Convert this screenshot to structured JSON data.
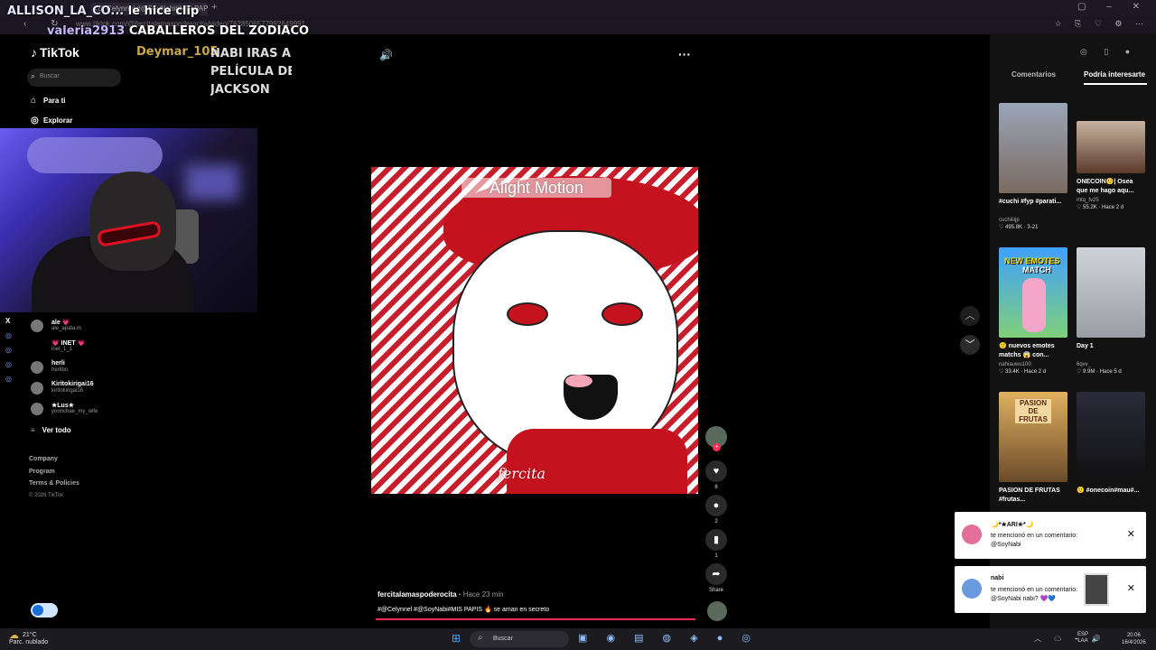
{
  "browser": {
    "tab_title": "(8) Celynnel #@SoyNabi#MIS PAPI...",
    "url": "www.tiktok.com/@fercitalamaspoderocita/video/7628506577992649991"
  },
  "stream_overlay": {
    "line1_name": "ALLISON_LA_CO...",
    "line1_msg": "le hice clip",
    "line2_user": "valeria2913",
    "line2_msg": "CABALLEROS DEL ZODIACO",
    "deymar": "Deymar_105",
    "nabi_line1": "NABI IRAS A V",
    "nabi_line2": "PELÍCULA DE I",
    "nabi_line3": "JACKSON"
  },
  "sidebar": {
    "logo": "TikTok",
    "search_placeholder": "Buscar",
    "nav": [
      {
        "label": "Para ti",
        "icon": "home-icon"
      },
      {
        "label": "Explorar",
        "icon": "compass-icon"
      }
    ],
    "following": [
      {
        "name": "ale 💗",
        "handle": "ale_apata.m"
      },
      {
        "name": "💗 INET 💗",
        "handle": "inet_1_1"
      },
      {
        "name": "herli",
        "handle": "herlibo"
      },
      {
        "name": "Kiritokirigai16",
        "handle": "kiritokirigai16"
      },
      {
        "name": "★Lus★",
        "handle": "yoonchae_my_wife"
      }
    ],
    "ver_todo": "Ver todo",
    "footer": [
      "Company",
      "Program",
      "Terms & Policies"
    ],
    "copyright": "© 2026 TikTok"
  },
  "video": {
    "watermark": "Alight Motion",
    "signature": "fercita",
    "author": "fercitalamaspoderocita",
    "time": "Hace 23 min",
    "caption": "#@Celynnel #@SoyNabi#MIS PAPIS 🔥 se aman en secreto",
    "progress": 1.0
  },
  "actions": {
    "likes": "8",
    "comments": "2",
    "saves": "1",
    "share": "Share"
  },
  "right_panel": {
    "tab_comments": "Comentarios",
    "tab_interest": "Podría interesarte",
    "cards": [
      {
        "title": "#cuchi #fyp #parati...",
        "user": "cuchiiiijp",
        "stats": "♡ 495.8K · 3-21"
      },
      {
        "title": "ONECOIN🙂| Osea que me hago aqu...",
        "user": "mtq_fv25",
        "stats": "♡ 55.2K · Hace 2 d"
      },
      {
        "title": "🙂 nuevos emotes matchs 😱 con...",
        "user": "nahiauwu100",
        "stats": "♡ 33.4K · Hace 2 d"
      },
      {
        "title": "Day 1",
        "user": "6qvv_",
        "stats": "♡ 9.9M · Hace 5 d"
      },
      {
        "title": "PASION DE FRUTAS #frutas...",
        "user": "",
        "stats": ""
      },
      {
        "title": "🙂 #onecoin#mau#...",
        "user": "",
        "stats": ""
      }
    ],
    "thumb_labels": [
      "NEW EMOTES",
      "MATCH",
      "PASION DE FRUTAS"
    ]
  },
  "notifications": [
    {
      "title": "🌙*★ARI★*🌙",
      "text": "te mencionó en un comentario: @SoyNabi"
    },
    {
      "title": "nabi",
      "text": "te mencionó en un comentario: @SoyNabi nabi? 💜💙"
    }
  ],
  "taskbar": {
    "temp": "21°C",
    "weather": "Parc. nublado",
    "search": "Buscar",
    "lang1": "ESP",
    "lang2": "LAA",
    "time": "20:06",
    "date": "16/4/2026"
  }
}
